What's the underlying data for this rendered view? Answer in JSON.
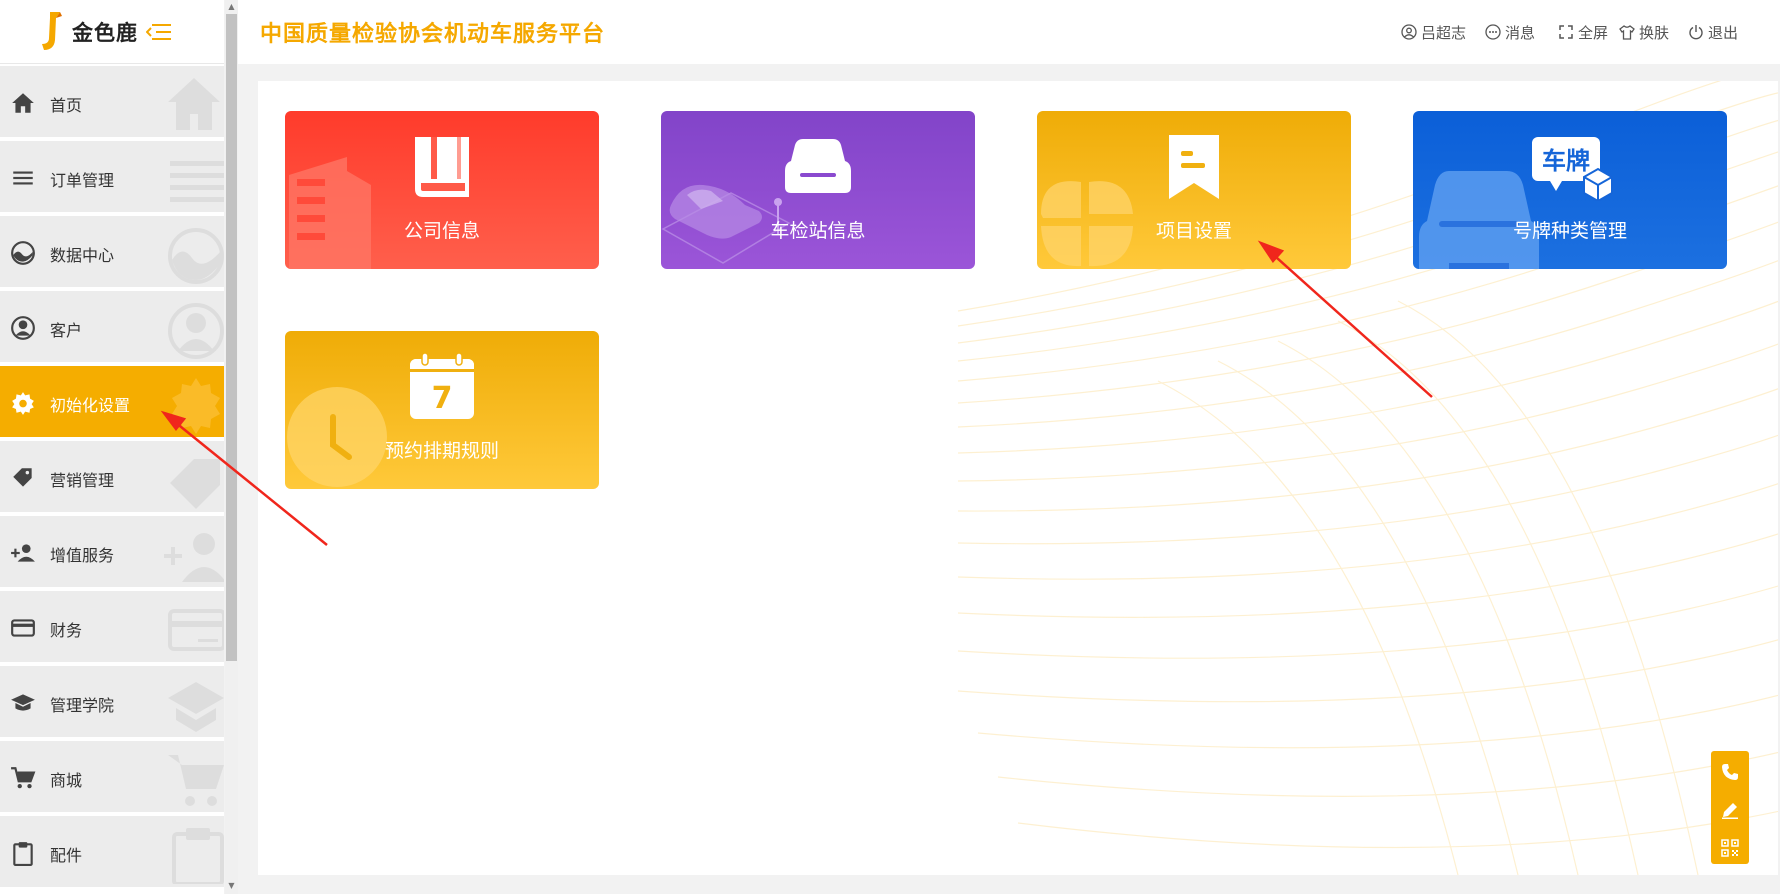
{
  "brand": {
    "logo_text": "金色鹿",
    "accent": "#f5ad00"
  },
  "header": {
    "title": "中国质量检验协会机动车服务平台",
    "actions": [
      {
        "icon": "user-icon",
        "label": "吕超志"
      },
      {
        "icon": "message-icon",
        "label": "消息"
      },
      {
        "icon": "fullscreen-icon",
        "label": "全屏"
      },
      {
        "icon": "shirt-icon",
        "label": "换肤"
      },
      {
        "icon": "power-icon",
        "label": "退出"
      }
    ]
  },
  "sidebar": {
    "items": [
      {
        "label": "首页",
        "icon": "home-icon",
        "active": false
      },
      {
        "label": "订单管理",
        "icon": "list-icon",
        "active": false
      },
      {
        "label": "数据中心",
        "icon": "chart-circle-icon",
        "active": false
      },
      {
        "label": "客户",
        "icon": "user-circle-icon",
        "active": false
      },
      {
        "label": "初始化设置",
        "icon": "gear-icon",
        "active": true
      },
      {
        "label": "营销管理",
        "icon": "tag-icon",
        "active": false
      },
      {
        "label": "增值服务",
        "icon": "add-user-icon",
        "active": false
      },
      {
        "label": "财务",
        "icon": "credit-card-icon",
        "active": false
      },
      {
        "label": "管理学院",
        "icon": "graduation-cap-icon",
        "active": false
      },
      {
        "label": "商城",
        "icon": "cart-icon",
        "active": false
      },
      {
        "label": "配件",
        "icon": "clipboard-icon",
        "active": false
      }
    ]
  },
  "cards": [
    {
      "title": "公司信息",
      "icon": "book-icon",
      "color": "#ff3b2b"
    },
    {
      "title": "车检站信息",
      "icon": "car-icon",
      "color": "#8244c9"
    },
    {
      "title": "项目设置",
      "icon": "bookmark-icon",
      "color": "#efac07"
    },
    {
      "title": "号牌种类管理",
      "icon": "license-plate-icon",
      "badge_text": "车牌",
      "color": "#0b5fd8"
    },
    {
      "title": "预约排期规则",
      "icon": "calendar-icon",
      "calendar_day": "7",
      "color": "#efac07"
    }
  ],
  "float_toolbar": [
    {
      "icon": "phone-icon"
    },
    {
      "icon": "edit-icon"
    },
    {
      "icon": "qrcode-icon"
    }
  ]
}
